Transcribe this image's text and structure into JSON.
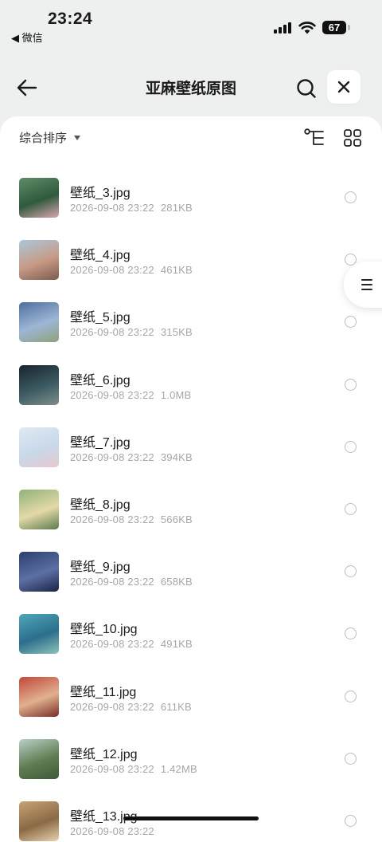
{
  "status_bar": {
    "time": "23:24",
    "back_app": "◀ 微信",
    "battery": "67"
  },
  "header": {
    "title": "亚麻壁纸原图"
  },
  "toolbar": {
    "sort_label": "综合排序"
  },
  "files": [
    {
      "name": "壁纸_3.jpg",
      "date": "2026-09-08 23:22",
      "size": "281KB",
      "thumb": [
        "#5f8d69",
        "#2f5a3c",
        "#d9a7b0"
      ]
    },
    {
      "name": "壁纸_4.jpg",
      "date": "2026-09-08 23:22",
      "size": "461KB",
      "thumb": [
        "#a9c7db",
        "#c89a86",
        "#7d5a4e"
      ]
    },
    {
      "name": "壁纸_5.jpg",
      "date": "2026-09-08 23:22",
      "size": "315KB",
      "thumb": [
        "#4d6f9d",
        "#9db6d6",
        "#8da27a"
      ]
    },
    {
      "name": "壁纸_6.jpg",
      "date": "2026-09-08 23:22",
      "size": "1.0MB",
      "thumb": [
        "#18242c",
        "#3c5a62",
        "#7d8f8c"
      ]
    },
    {
      "name": "壁纸_7.jpg",
      "date": "2026-09-08 23:22",
      "size": "394KB",
      "thumb": [
        "#dfe9f2",
        "#c8d9ea",
        "#e6c7cf"
      ]
    },
    {
      "name": "壁纸_8.jpg",
      "date": "2026-09-08 23:22",
      "size": "566KB",
      "thumb": [
        "#8fb27a",
        "#e4d9a8",
        "#5b7b4d"
      ]
    },
    {
      "name": "壁纸_9.jpg",
      "date": "2026-09-08 23:22",
      "size": "658KB",
      "thumb": [
        "#2b3f6e",
        "#5d6fa4",
        "#1a2444"
      ]
    },
    {
      "name": "壁纸_10.jpg",
      "date": "2026-09-08 23:22",
      "size": "491KB",
      "thumb": [
        "#4fa7b9",
        "#2c6e8c",
        "#8cc3b8"
      ]
    },
    {
      "name": "壁纸_11.jpg",
      "date": "2026-09-08 23:22",
      "size": "611KB",
      "thumb": [
        "#c2473a",
        "#e0b18f",
        "#7a2b25"
      ]
    },
    {
      "name": "壁纸_12.jpg",
      "date": "2026-09-08 23:22",
      "size": "1.42MB",
      "thumb": [
        "#b9cfc7",
        "#5f7d52",
        "#3e5a3a"
      ]
    },
    {
      "name": "壁纸_13.jpg",
      "date": "2026-09-08 23:22",
      "size": "",
      "thumb": [
        "#c9a274",
        "#8a6a45",
        "#e8d2b0"
      ]
    }
  ]
}
